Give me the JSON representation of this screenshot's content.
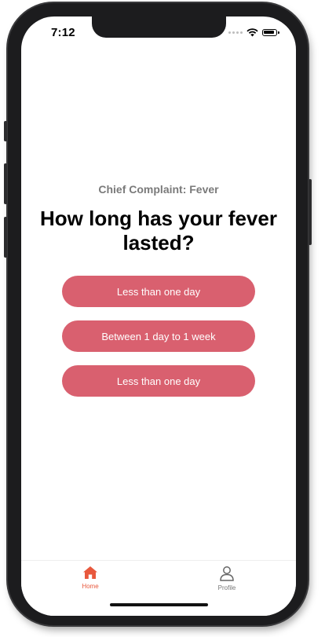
{
  "status_bar": {
    "time": "7:12",
    "icons": [
      "signal-dots-icon",
      "wifi-icon",
      "battery-icon"
    ]
  },
  "complaint": {
    "label": "Chief Complaint: Fever"
  },
  "question": {
    "text": "How long has your fever lasted?"
  },
  "options": [
    {
      "label": "Less than one day"
    },
    {
      "label": "Between 1 day to 1 week"
    },
    {
      "label": "Less than one day"
    }
  ],
  "tab_bar": {
    "home": {
      "label": "Home",
      "icon": "home-icon"
    },
    "profile": {
      "label": "Profile",
      "icon": "user-icon"
    }
  },
  "colors": {
    "option_button": "#d9606f",
    "active_tab": "#e8583d",
    "inactive_tab": "#777777",
    "complaint_text": "#7a7a7a"
  }
}
